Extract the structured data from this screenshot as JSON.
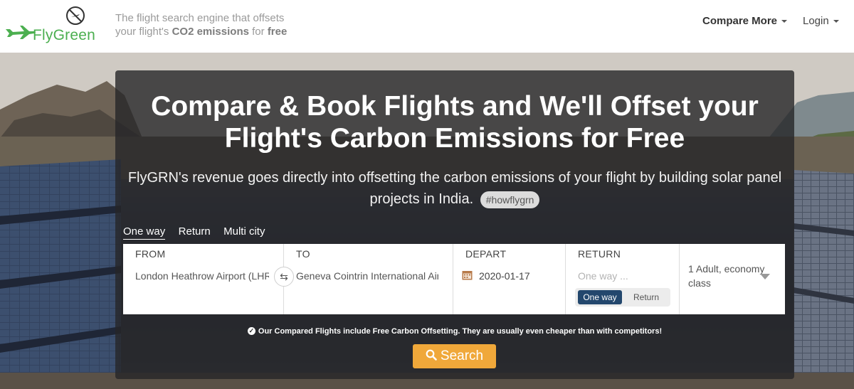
{
  "header": {
    "logo_text": "FlyGreen",
    "tagline": {
      "line1": "The flight search engine that offsets",
      "prefix": "your flight's ",
      "co2": "CO2 emissions",
      "middle": " for ",
      "free": "free"
    },
    "nav": {
      "compare": "Compare More",
      "login": "Login"
    }
  },
  "hero": {
    "headline_line1": "Compare & Book Flights and We'll Offset your",
    "headline_line2": "Flight's Carbon Emissions for Free",
    "sub_line1": "FlyGRN's revenue goes directly into offsetting the carbon emissions of your flight by building solar panel",
    "sub_line2": "projects in India.",
    "hashtag": "#howflygrn"
  },
  "trip_tabs": [
    "One way",
    "Return",
    "Multi city"
  ],
  "form": {
    "from_label": "FROM",
    "from_value": "London Heathrow Airport (LHR)",
    "to_label": "TO",
    "to_value": "Geneva Cointrin International Airport",
    "depart_label": "DEPART",
    "depart_value": "2020-01-17",
    "return_label": "RETURN",
    "return_placeholder": "One way ...",
    "toggle_one_way": "One way",
    "toggle_return": "Return",
    "passengers": "1 Adult, economy class"
  },
  "notice": "Our Compared Flights include Free Carbon Offsetting. They are usually even cheaper than with competitors!",
  "search_label": "Search",
  "colors": {
    "brand_green": "#4caf50",
    "search_orange": "#f0a83a",
    "toggle_active": "#23476d"
  }
}
